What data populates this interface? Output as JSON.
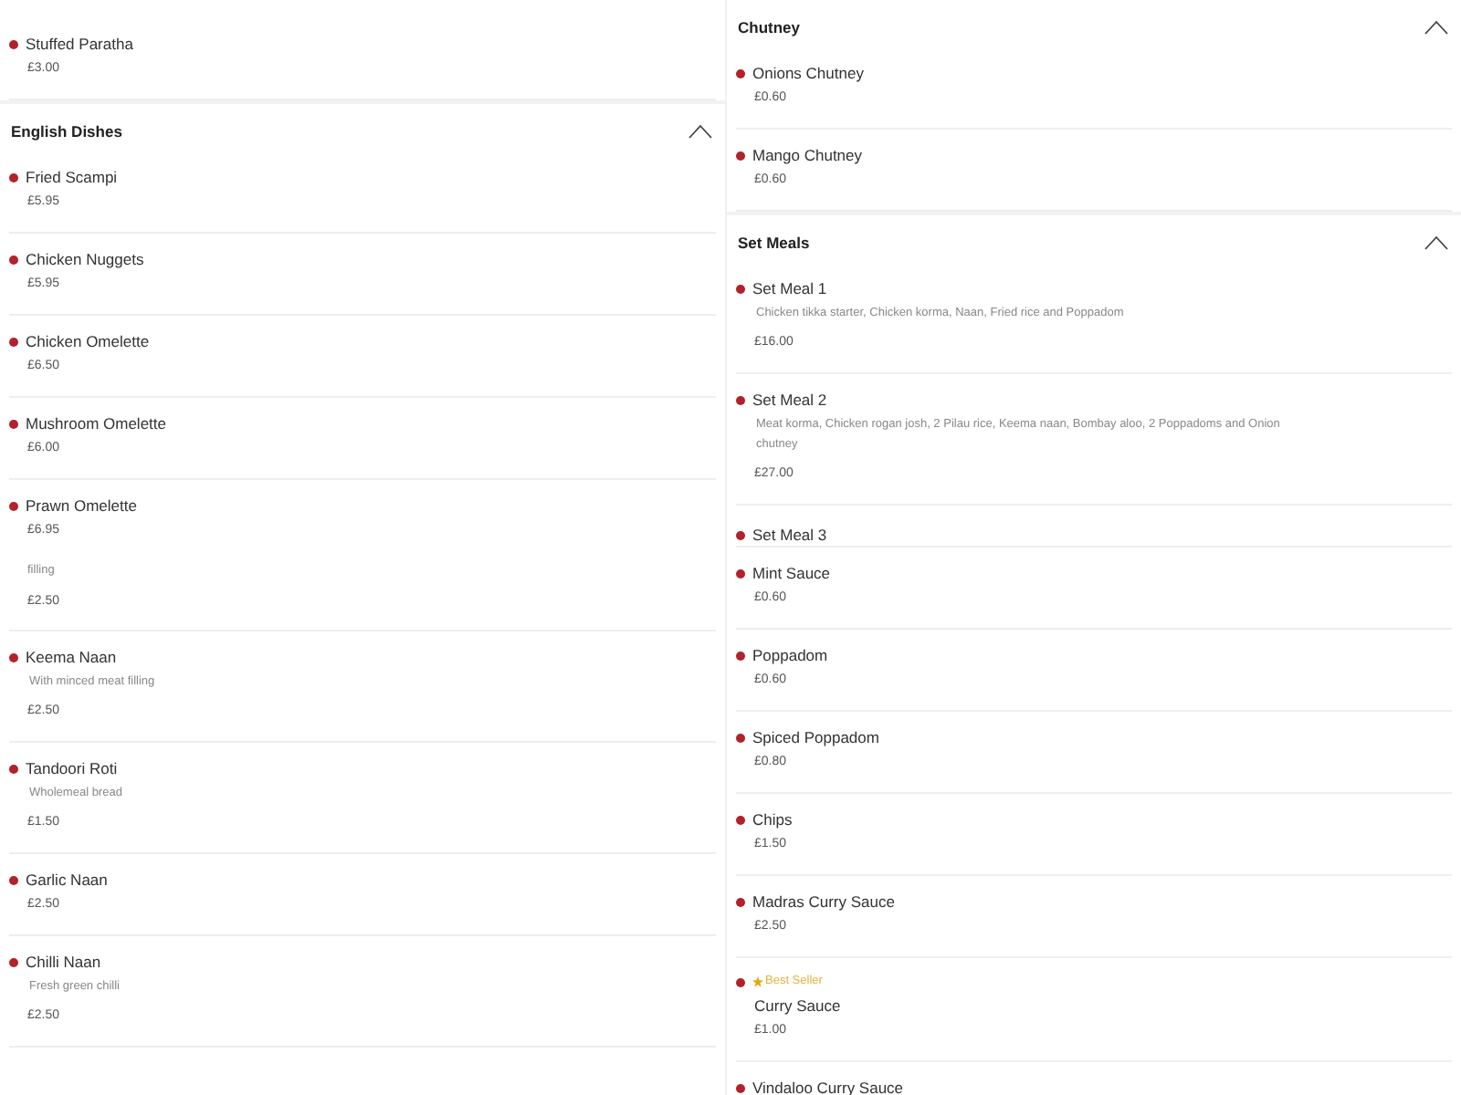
{
  "columns": [
    {
      "sections": [
        {
          "items": [
            {
              "kind": "item",
              "name": "Stuffed Paratha",
              "price": "£3.00"
            }
          ]
        },
        {
          "title": "English Dishes",
          "expanded": true,
          "items": [
            {
              "kind": "item",
              "name": "Fried Scampi",
              "price": "£5.95"
            },
            {
              "kind": "item",
              "name": "Chicken Nuggets",
              "price": "£5.95"
            },
            {
              "kind": "item",
              "name": "Chicken Omelette",
              "price": "£6.50"
            },
            {
              "kind": "item",
              "name": "Mushroom Omelette",
              "price": "£6.00"
            },
            {
              "kind": "item",
              "name": "Prawn Omelette",
              "price": "£6.95"
            },
            {
              "kind": "fragment",
              "description": "filling",
              "price": "£2.50"
            },
            {
              "kind": "item",
              "name": "Keema Naan",
              "description": "With minced meat filling",
              "price": "£2.50"
            },
            {
              "kind": "item",
              "name": "Tandoori Roti",
              "description": "Wholemeal bread",
              "price": "£1.50"
            },
            {
              "kind": "item",
              "name": "Garlic Naan",
              "price": "£2.50"
            },
            {
              "kind": "item",
              "name": "Chilli Naan",
              "description": "Fresh green chilli",
              "price": "£2.50"
            }
          ]
        }
      ]
    },
    {
      "sections": [
        {
          "title": "Chutney",
          "expanded": true,
          "items": [
            {
              "kind": "item",
              "name": "Onions Chutney",
              "price": "£0.60"
            },
            {
              "kind": "item",
              "name": "Mango Chutney",
              "price": "£0.60"
            }
          ]
        },
        {
          "title": "Set Meals",
          "expanded": true,
          "items": [
            {
              "kind": "item",
              "name": "Set Meal 1",
              "description": "Chicken tikka starter, Chicken korma, Naan, Fried rice and Poppadom",
              "price": "£16.00"
            },
            {
              "kind": "item",
              "name": "Set Meal 2",
              "description": "Meat korma, Chicken rogan josh, 2 Pilau rice, Keema naan, Bombay aloo, 2 Poppadoms and Onion chutney",
              "price": "£27.00"
            },
            {
              "kind": "cut",
              "name": "Set Meal 3"
            },
            {
              "kind": "item",
              "name": "Mint Sauce",
              "price": "£0.60"
            },
            {
              "kind": "item",
              "name": "Poppadom",
              "price": "£0.60"
            },
            {
              "kind": "item",
              "name": "Spiced Poppadom",
              "price": "£0.80"
            },
            {
              "kind": "item",
              "name": "Chips",
              "price": "£1.50"
            },
            {
              "kind": "item",
              "name": "Madras Curry Sauce",
              "price": "£2.50"
            },
            {
              "kind": "item",
              "badge": "Best Seller",
              "name": "Curry Sauce",
              "price": "£1.00"
            },
            {
              "kind": "item",
              "name": "Vindaloo Curry Sauce"
            }
          ]
        }
      ]
    }
  ]
}
